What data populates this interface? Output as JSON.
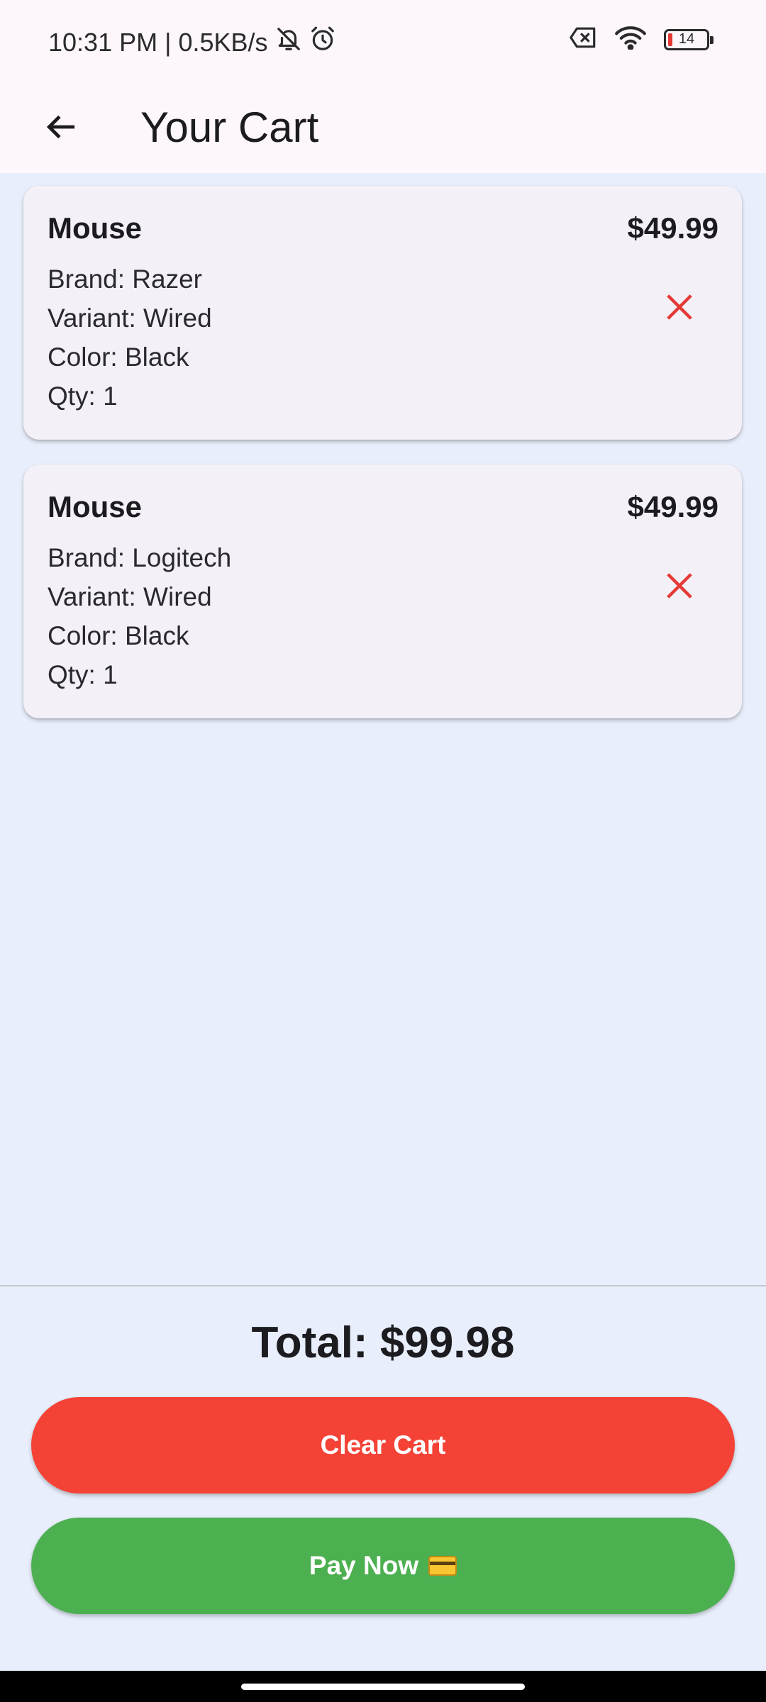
{
  "status_bar": {
    "time_network": "10:31 PM | 0.5KB/s",
    "battery_level": "14",
    "icons": [
      "bell-off-icon",
      "alarm-icon",
      "sim-off-icon",
      "wifi-icon",
      "battery-icon"
    ]
  },
  "app_bar": {
    "title": "Your Cart",
    "back_icon": "arrow-left-icon"
  },
  "cart": {
    "items": [
      {
        "name": "Mouse",
        "price": "$49.99",
        "brand": "Brand: Razer",
        "variant": "Variant: Wired",
        "color": "Color: Black",
        "qty": "Qty: 1",
        "remove_icon": "close-icon"
      },
      {
        "name": "Mouse",
        "price": "$49.99",
        "brand": "Brand: Logitech",
        "variant": "Variant: Wired",
        "color": "Color: Black",
        "qty": "Qty: 1",
        "remove_icon": "close-icon"
      }
    ]
  },
  "summary": {
    "total": "Total: $99.98"
  },
  "actions": {
    "clear_label": "Clear Cart",
    "pay_label": "Pay Now",
    "pay_icon": "credit-card-emoji"
  },
  "colors": {
    "page_background": "#e8eefb",
    "app_bar_background": "#fdf7fc",
    "card_background": "#f4f0f7",
    "remove_icon": "#e53935",
    "clear_button": "#f44336",
    "pay_button": "#4caf50"
  }
}
